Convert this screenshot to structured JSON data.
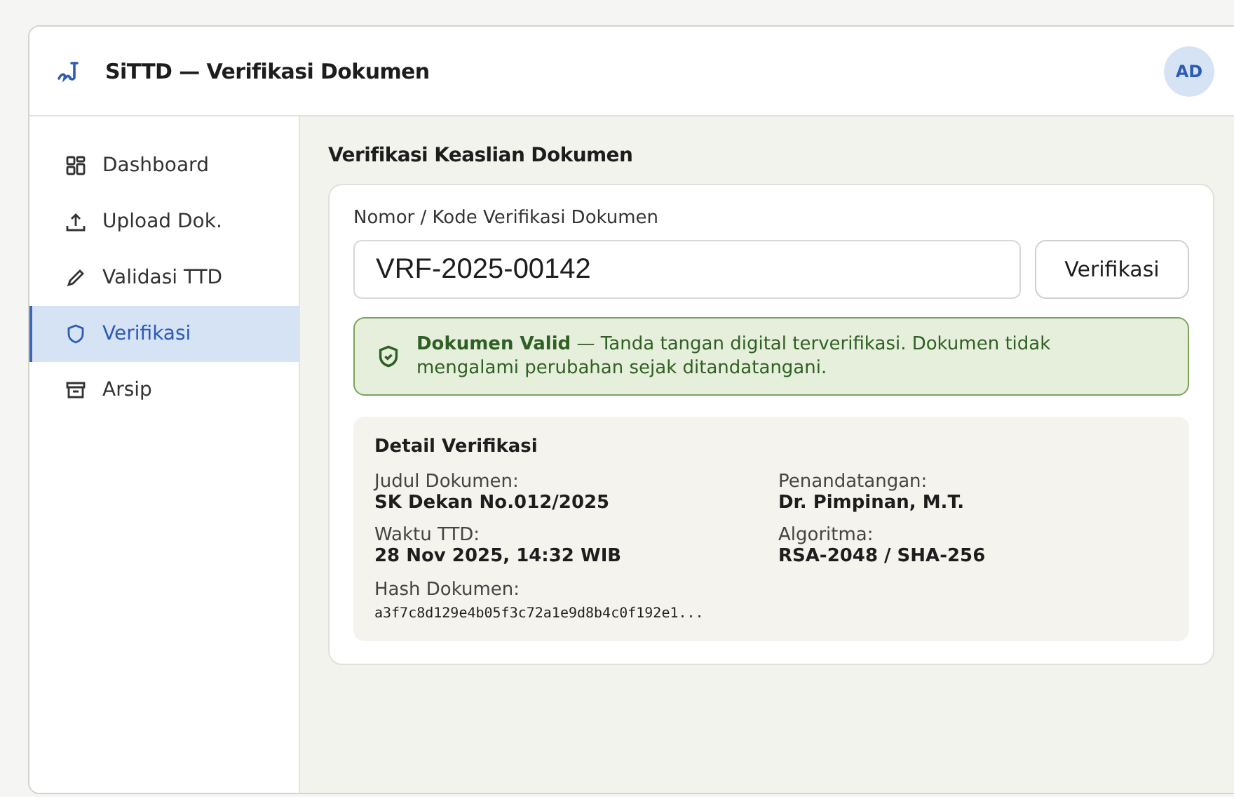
{
  "header": {
    "title": "SiTTD — Verifikasi Dokumen",
    "avatar": "AD"
  },
  "sidebar": {
    "items": [
      {
        "label": "Dashboard",
        "selected": false
      },
      {
        "label": "Upload Dok.",
        "selected": false
      },
      {
        "label": "Validasi TTD",
        "selected": false
      },
      {
        "label": "Verifikasi",
        "selected": true
      },
      {
        "label": "Arsip",
        "selected": false
      }
    ]
  },
  "main": {
    "heading": "Verifikasi Keaslian Dokumen",
    "field": {
      "label": "Nomor / Kode Verifikasi Dokumen",
      "value": "VRF-2025-00142"
    },
    "button": "Verifikasi",
    "alert": {
      "kind": "success",
      "text": "**Dokumen Valid** — Tanda tangan digital terverifikasi. Dokumen tidak mengalami perubahan sejak ditandatangani."
    },
    "detail": {
      "title": "Detail Verifikasi",
      "fields": [
        {
          "label": "Judul Dokumen:",
          "value": "SK Dekan No.012/2025"
        },
        {
          "label": "Penandatangan:",
          "value": "Dr. Pimpinan, M.T."
        },
        {
          "label": "Waktu TTD:",
          "value": "28 Nov 2025, 14:32 WIB"
        },
        {
          "label": "Algoritma:",
          "value": "RSA-2048 / SHA-256"
        }
      ],
      "hash": {
        "label": "Hash Dokumen:",
        "value": "a3f7c8d129e4b05f3c72a1e9d8b4c0f192e1..."
      }
    }
  }
}
